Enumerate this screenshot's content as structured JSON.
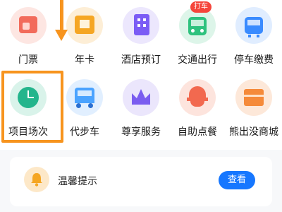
{
  "grid": {
    "row1": [
      {
        "label": "门票",
        "icon": "ticket-icon",
        "color": "#f26b5b"
      },
      {
        "label": "年卡",
        "icon": "annual-card-icon",
        "color": "#f5a623"
      },
      {
        "label": "酒店预订",
        "icon": "hotel-icon",
        "color": "#7b5cf5"
      },
      {
        "label": "交通出行",
        "icon": "bus-icon",
        "color": "#2ec27e"
      },
      {
        "label": "停车缴费",
        "icon": "parking-icon",
        "color": "#3a8bff"
      }
    ],
    "row2": [
      {
        "label": "项目场次",
        "icon": "clock-icon",
        "color": "#23b58c"
      },
      {
        "label": "代步车",
        "icon": "cart-icon",
        "color": "#4aa3ff"
      },
      {
        "label": "尊享服务",
        "icon": "crown-icon",
        "color": "#7a5cf0"
      },
      {
        "label": "自助点餐",
        "icon": "food-bowl-icon",
        "color": "#f2694f"
      },
      {
        "label": "熊出没商城",
        "icon": "shop-icon",
        "color": "#f58a3a"
      }
    ]
  },
  "badge": {
    "text": "打车"
  },
  "notice": {
    "text": "温馨提示",
    "button": "查看",
    "icon": "bell-icon"
  },
  "colors": {
    "highlight": "#f7941e",
    "button": "#1677ff"
  }
}
